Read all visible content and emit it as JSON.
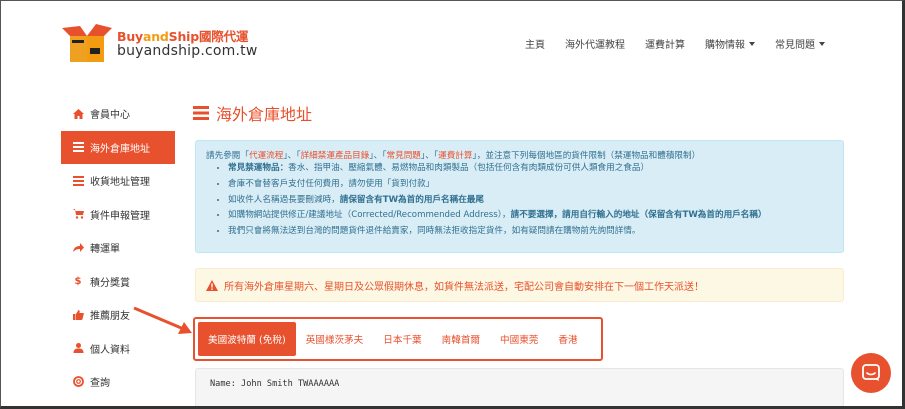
{
  "header": {
    "brand": "Buy",
    "brand_and": "and",
    "brand_ship": "Ship國際代運",
    "domain": "buyandship.com.tw",
    "nav": [
      {
        "label": "主頁",
        "dropdown": false
      },
      {
        "label": "海外代運教程",
        "dropdown": false
      },
      {
        "label": "運費計算",
        "dropdown": false
      },
      {
        "label": "購物情報",
        "dropdown": true
      },
      {
        "label": "常見問題",
        "dropdown": true
      }
    ]
  },
  "sidebar": {
    "items": [
      {
        "label": "會員中心",
        "icon": "home-icon",
        "active": false
      },
      {
        "label": "海外倉庫地址",
        "icon": "list-icon",
        "active": true
      },
      {
        "label": "收貨地址管理",
        "icon": "address-list-icon",
        "active": false
      },
      {
        "label": "貨件申報管理",
        "icon": "cart-icon",
        "active": false
      },
      {
        "label": "轉運單",
        "icon": "share-icon",
        "active": false
      },
      {
        "label": "積分獎賞",
        "icon": "dollar-icon",
        "active": false
      },
      {
        "label": "推薦朋友",
        "icon": "thumbs-up-icon",
        "active": false
      },
      {
        "label": "個人資料",
        "icon": "user-icon",
        "active": false
      },
      {
        "label": "查詢",
        "icon": "lifebuoy-icon",
        "active": false
      }
    ]
  },
  "main": {
    "title": "海外倉庫地址",
    "info": {
      "lead_a": "請先參閱「",
      "link1": "代運流程",
      "lead_b": "」、「",
      "link2": "詳細禁運產品目錄",
      "lead_c": "」、「",
      "link3": "常見問題",
      "lead_d": "」、「",
      "link4": "運費計算",
      "lead_e": "」，並注意下列每個地區的貨件限制（禁運物品和體積限制）",
      "bullets": [
        {
          "bold": "常見禁運物品：",
          "text": "香水、指甲油、壓縮氣體、易燃物品和肉類製品（包括任何含有肉類成份可供人類食用之食品）"
        },
        {
          "bold": "",
          "text": "倉庫不會替客戶支付任何費用，請勿使用「貨到付款」"
        },
        {
          "bold": "",
          "text": "如收件人名稱過長要刪減時，",
          "bold2": "請保留含有TW為首的用戶名稱在最尾"
        },
        {
          "bold": "",
          "text": "如購物網站提供修正/建議地址（Corrected/Recommended Address），",
          "bold2": "請不要選擇，請用自行輸入的地址（保留含有TW為首的用戶名稱）"
        },
        {
          "bold": "",
          "text": "我們只會將無法送到台灣的問題貨件退件給賣家，同時無法拒收指定貨件，如有疑問請在購物前先詢問詳情。"
        }
      ]
    },
    "warning": "所有海外倉庫星期六、星期日及公眾假期休息，如貨件無法派送，宅配公司會自動安排在下一個工作天派送！",
    "tabs": [
      {
        "label": "美國波特蘭 (免稅)",
        "active": true
      },
      {
        "label": "英國様茨茅夫",
        "active": false
      },
      {
        "label": "日本千葉",
        "active": false
      },
      {
        "label": "南韓首爾",
        "active": false
      },
      {
        "label": "中國東莞",
        "active": false
      },
      {
        "label": "香港",
        "active": false
      }
    ],
    "address_name": "Name: John Smith TWAAAAAA"
  },
  "colors": {
    "accent": "#e8512e",
    "info_bg": "#d9edf7",
    "info_text": "#31708f",
    "warn_bg": "#fcf8e3"
  }
}
